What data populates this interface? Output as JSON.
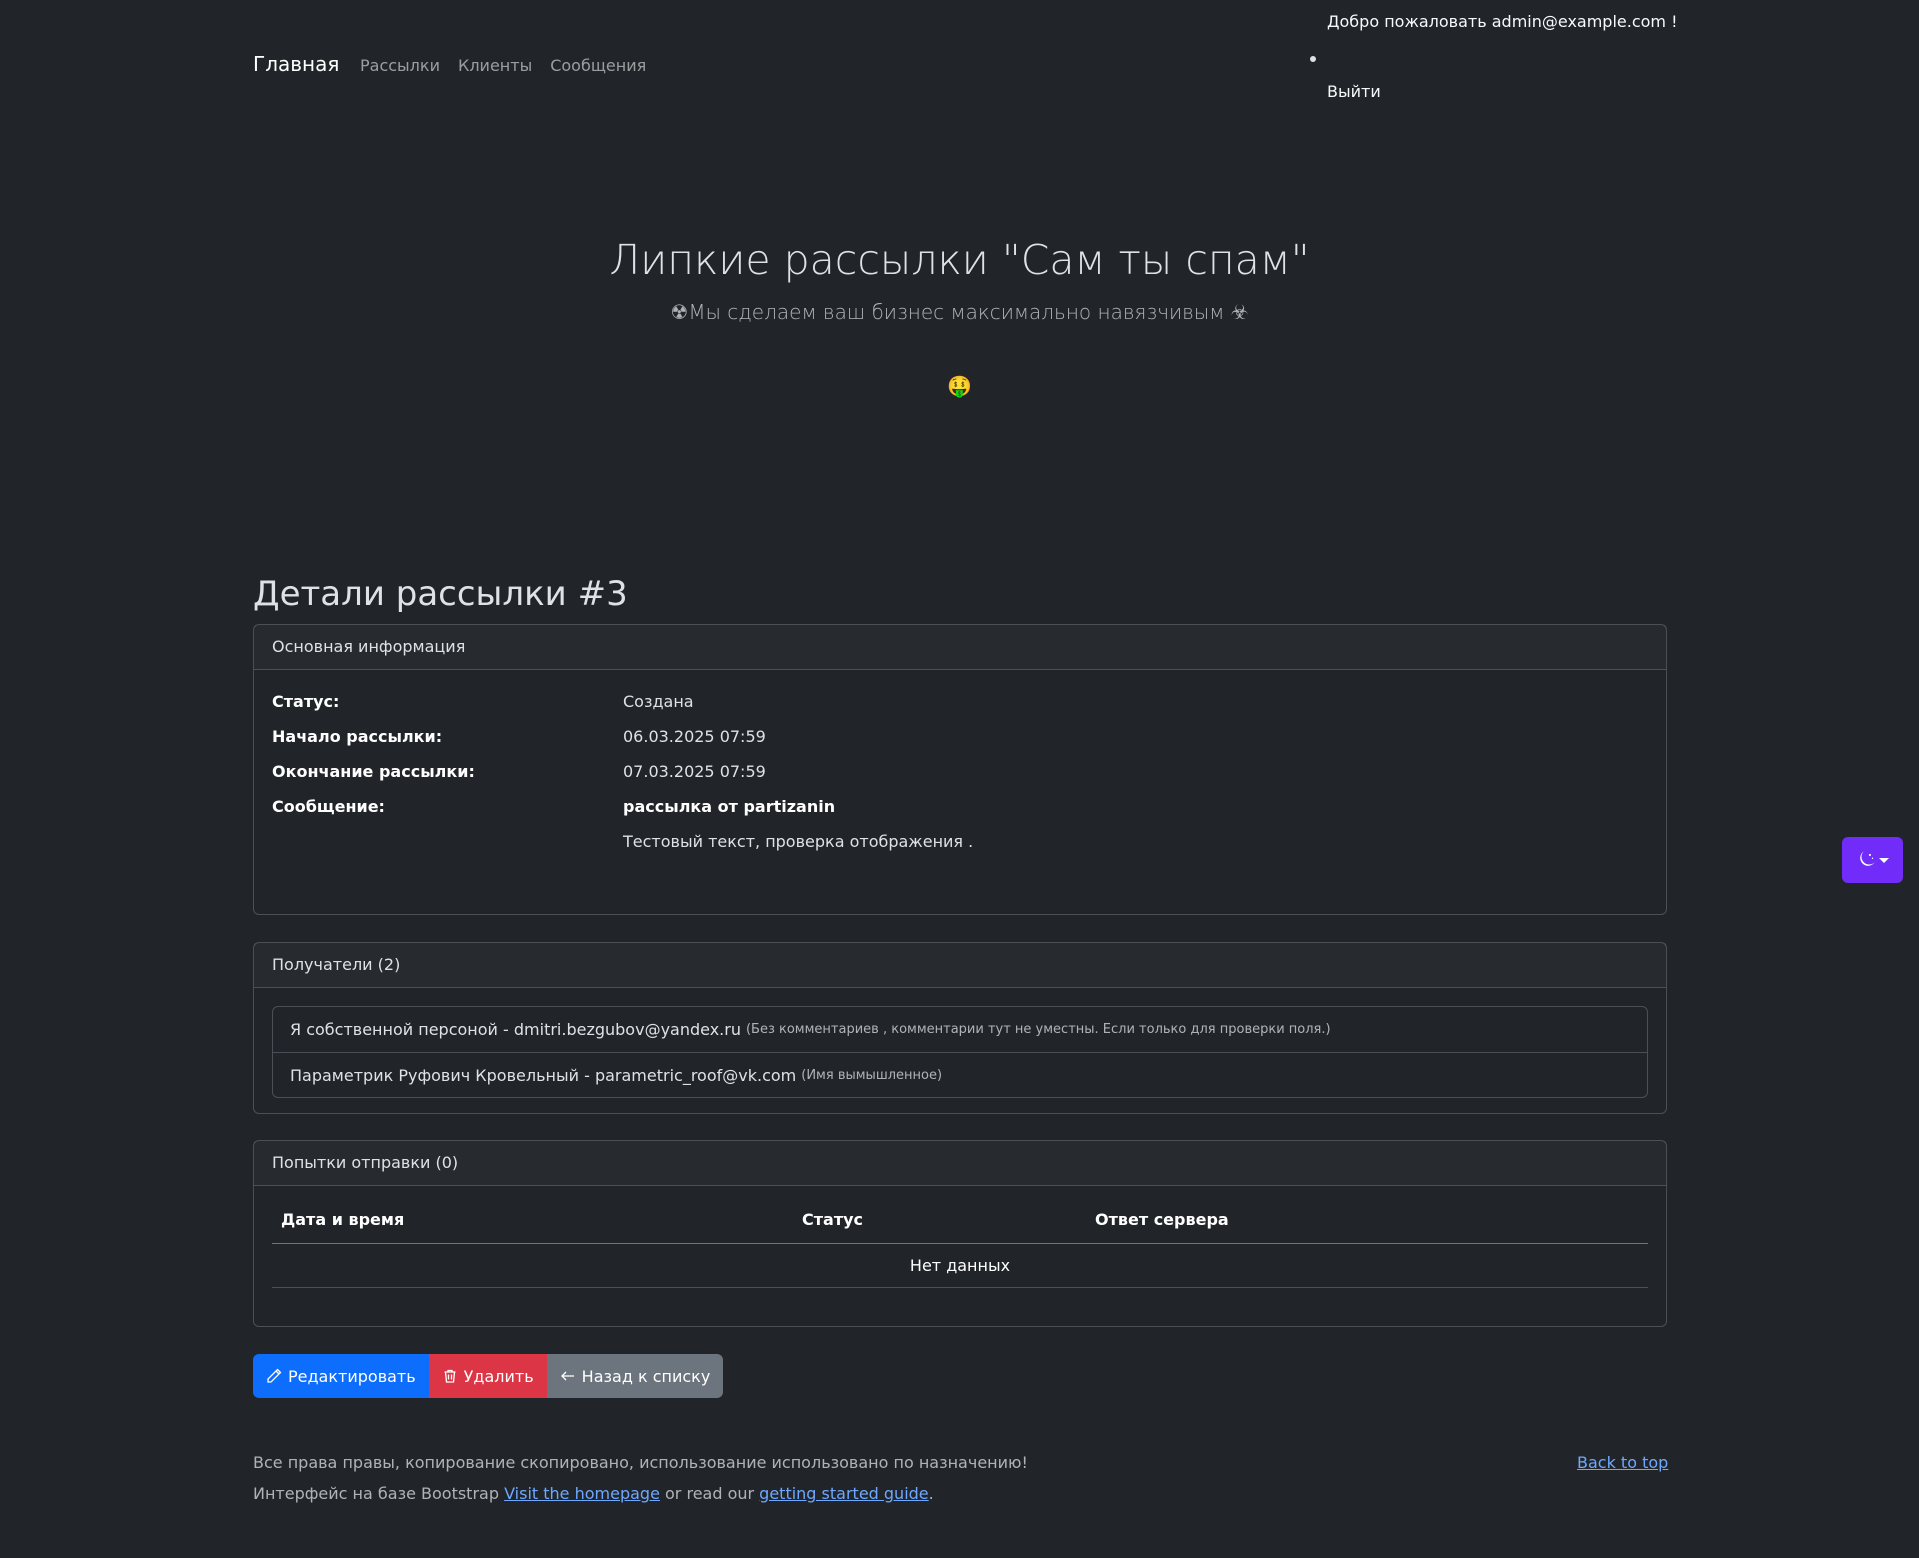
{
  "header": {
    "welcome": "Добро пожаловать admin@example.com !",
    "logout": "Выйти",
    "brand": "Главная",
    "nav": [
      "Рассылки",
      "Клиенты",
      "Сообщения"
    ]
  },
  "hero": {
    "title": "Липкие рассылки \"Сам ты спам\"",
    "subtitle": "☢Мы сделаем ваш бизнес максимально навязчивым ☣",
    "emoji": "🤑"
  },
  "page": {
    "heading": "Детали рассылки #3"
  },
  "info_card": {
    "header": "Основная информация",
    "rows": [
      {
        "label": "Статус:",
        "value": "Создана"
      },
      {
        "label": "Начало рассылки:",
        "value": "06.03.2025 07:59"
      },
      {
        "label": "Окончание рассылки:",
        "value": "07.03.2025 07:59"
      },
      {
        "label": "Сообщение:",
        "value": "рассылка от partizanin"
      }
    ],
    "message_body": "Тестовый текст, проверка отображения ."
  },
  "recipients_card": {
    "header": "Получатели (2)",
    "items": [
      {
        "text": "Я собственной персоной - dmitri.bezgubov@yandex.ru",
        "note": "(Без комментариев , комментарии тут не уместны. Если только для проверки поля.)"
      },
      {
        "text": "Параметрик Руфович Кровельный - parametric_roof@vk.com",
        "note": "(Имя вымышленное)"
      }
    ]
  },
  "attempts_card": {
    "header": "Попытки отправки (0)",
    "columns": [
      "Дата и время",
      "Статус",
      "Ответ сервера"
    ],
    "empty": "Нет данных"
  },
  "actions": {
    "edit": "Редактировать",
    "delete": "Удалить",
    "back": "Назад к списку"
  },
  "footer": {
    "line1": "Все права правы, копирование скопировано, использование использовано по назначению!",
    "line2_prefix": "Интерфейс на базе Bootstrap ",
    "homepage_link": "Visit the homepage",
    "line2_middle": " or read our ",
    "guide_link": "getting started guide",
    "line2_suffix": ".",
    "back_to_top": "Back to top"
  },
  "colors": {
    "primary": "#0d6efd",
    "danger": "#dc3545",
    "secondary": "#6c757d",
    "theme_toggle": "#712cf9",
    "link": "#6ea8fe"
  },
  "icons": {
    "edit": "pencil-icon",
    "delete": "trash-icon",
    "back": "arrow-left-icon",
    "theme": "moon-icon"
  }
}
